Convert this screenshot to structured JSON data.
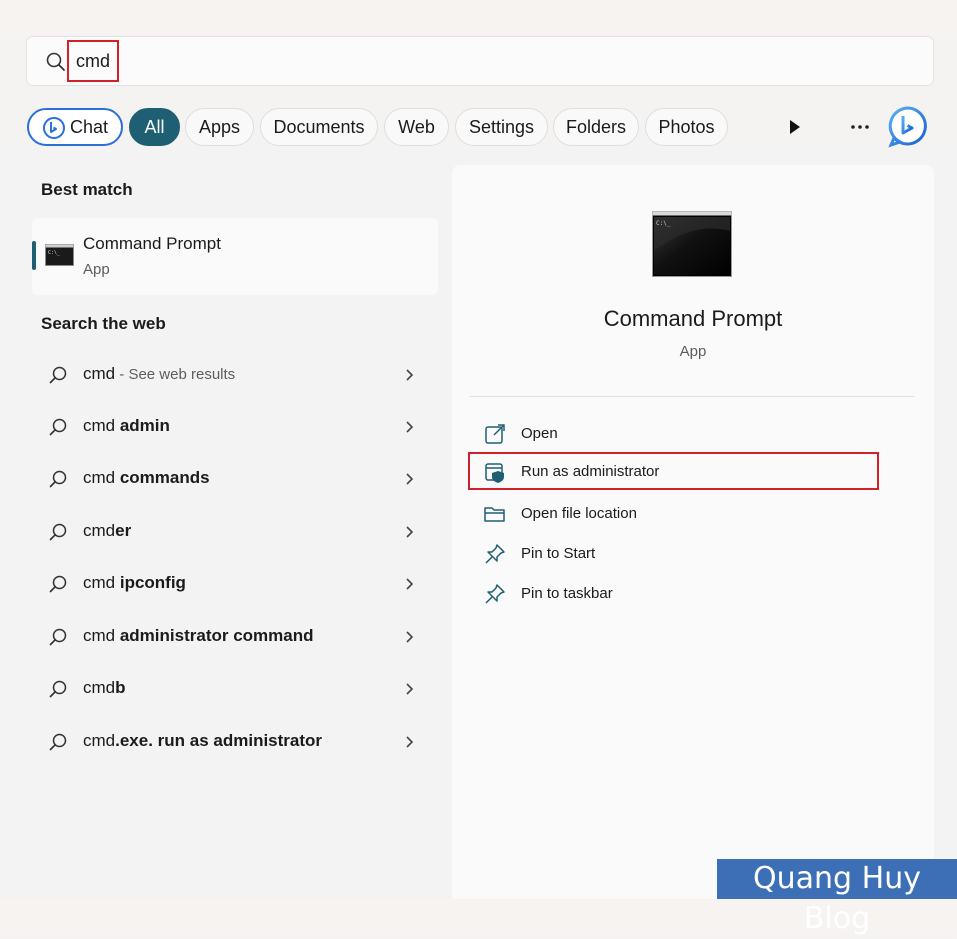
{
  "search": {
    "query": "cmd",
    "icon": "search-icon"
  },
  "filters": {
    "chat": "Chat",
    "all": "All",
    "apps": "Apps",
    "documents": "Documents",
    "web": "Web",
    "settings": "Settings",
    "folders": "Folders",
    "photos": "Photos"
  },
  "best_match": {
    "title": "Best match",
    "name": "Command Prompt",
    "type": "App"
  },
  "search_web": {
    "title": "Search the web",
    "items": [
      {
        "prefix": "cmd",
        "bold": "",
        "hint": " - See web results"
      },
      {
        "prefix": "cmd ",
        "bold": "admin",
        "hint": ""
      },
      {
        "prefix": "cmd ",
        "bold": "commands",
        "hint": ""
      },
      {
        "prefix": "cmd",
        "bold": "er",
        "hint": ""
      },
      {
        "prefix": "cmd ",
        "bold": "ipconfig",
        "hint": ""
      },
      {
        "prefix": "cmd ",
        "bold": "administrator command",
        "hint": ""
      },
      {
        "prefix": "cmd",
        "bold": "b",
        "hint": ""
      },
      {
        "prefix": "cmd",
        "bold": ".exe. run as administrator",
        "hint": ""
      }
    ]
  },
  "detail": {
    "name": "Command Prompt",
    "type": "App",
    "actions": {
      "open": "Open",
      "run_admin": "Run as administrator",
      "open_location": "Open file location",
      "pin_start": "Pin to Start",
      "pin_taskbar": "Pin to taskbar"
    }
  },
  "watermark": "Quang Huy Blog",
  "colors": {
    "accent": "#1f5f73",
    "highlight": "#d0202a",
    "chat_border": "#2a6fdb",
    "watermark_bg": "#3d6fb6"
  }
}
